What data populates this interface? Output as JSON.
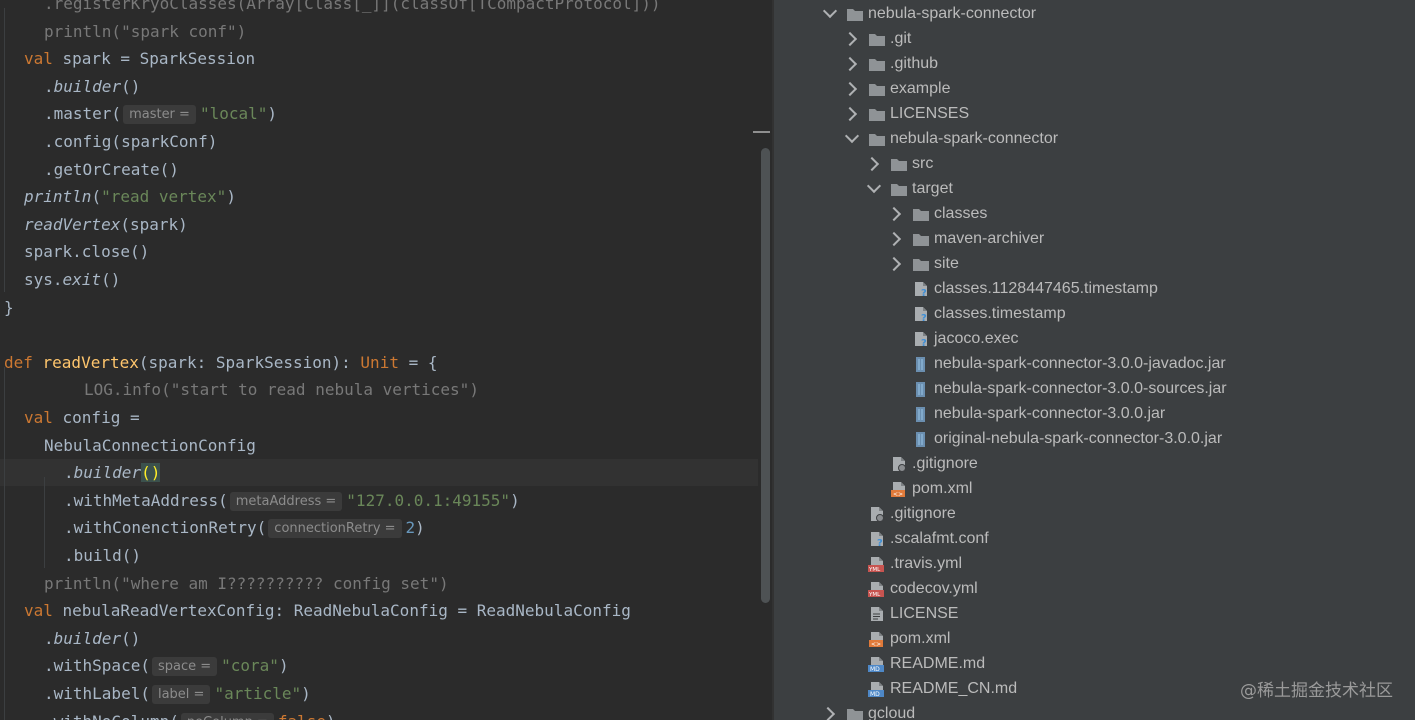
{
  "editor": {
    "lines": [
      {
        "indent": 1,
        "active": false,
        "tokens": [
          {
            "t": ".registerKryoClasses(Array[Class[_]](classOf[TCompactProtocol]))",
            "c": "tok-faded"
          }
        ]
      },
      {
        "indent": 1,
        "active": false,
        "tokens": [
          {
            "t": "println(\"spark conf\")",
            "c": "tok-faded"
          }
        ]
      },
      {
        "indent": 0,
        "active": false,
        "tokens": [
          {
            "t": "val ",
            "c": "tok-kw"
          },
          {
            "t": "spark = SparkSession"
          }
        ]
      },
      {
        "indent": 1,
        "active": false,
        "tokens": [
          {
            "t": "."
          },
          {
            "t": "builder",
            "c": "tok-it"
          },
          {
            "t": "()"
          }
        ]
      },
      {
        "indent": 1,
        "active": false,
        "tokens": [
          {
            "t": ".master("
          },
          {
            "hint": "master ="
          },
          {
            "t": "\"local\"",
            "c": "tok-str"
          },
          {
            "t": ")"
          }
        ]
      },
      {
        "indent": 1,
        "active": false,
        "tokens": [
          {
            "t": ".config(sparkConf)"
          }
        ]
      },
      {
        "indent": 1,
        "active": false,
        "tokens": [
          {
            "t": ".getOrCreate()"
          }
        ]
      },
      {
        "indent": 0,
        "active": false,
        "tokens": [
          {
            "t": "println",
            "c": "tok-it"
          },
          {
            "t": "("
          },
          {
            "t": "\"read vertex\"",
            "c": "tok-str"
          },
          {
            "t": ")"
          }
        ]
      },
      {
        "indent": 0,
        "active": false,
        "tokens": [
          {
            "t": "readVertex",
            "c": "tok-it"
          },
          {
            "t": "(spark)"
          }
        ]
      },
      {
        "indent": 0,
        "active": false,
        "tokens": [
          {
            "t": "spark.close()"
          }
        ]
      },
      {
        "indent": 0,
        "active": false,
        "tokens": [
          {
            "t": "sys."
          },
          {
            "t": "exit",
            "c": "tok-it"
          },
          {
            "t": "()"
          }
        ]
      },
      {
        "indent": -1,
        "active": false,
        "tokens": [
          {
            "t": "}"
          }
        ]
      },
      {
        "indent": -1,
        "active": false,
        "tokens": []
      },
      {
        "indent": -1,
        "active": false,
        "tokens": [
          {
            "t": "def ",
            "c": "tok-kw"
          },
          {
            "t": "readVertex",
            "c": "tok-fn"
          },
          {
            "t": "(spark: SparkSession): "
          },
          {
            "t": "Unit",
            "c": "tok-kw"
          },
          {
            "t": " = {"
          }
        ]
      },
      {
        "indent": 3,
        "active": false,
        "tokens": [
          {
            "t": "LOG.info(\"start to read nebula vertices\")",
            "c": "tok-faded"
          }
        ]
      },
      {
        "indent": 0,
        "active": false,
        "tokens": [
          {
            "t": "val ",
            "c": "tok-kw"
          },
          {
            "t": "config ="
          }
        ]
      },
      {
        "indent": 1,
        "active": false,
        "tokens": [
          {
            "t": "NebulaConnectionConfig"
          }
        ]
      },
      {
        "indent": 2,
        "active": true,
        "tokens": [
          {
            "t": "."
          },
          {
            "t": "builder",
            "c": "tok-it"
          },
          {
            "t": "()",
            "c": "tok-hl"
          }
        ]
      },
      {
        "indent": 2,
        "active": false,
        "tokens": [
          {
            "t": ".withMetaAddress("
          },
          {
            "hint": "metaAddress ="
          },
          {
            "t": "\"127.0.0.1:49155\"",
            "c": "tok-str"
          },
          {
            "t": ")"
          }
        ]
      },
      {
        "indent": 2,
        "active": false,
        "tokens": [
          {
            "t": ".withConenctionRetry("
          },
          {
            "hint": "connectionRetry ="
          },
          {
            "t": "2",
            "c": "tok-num"
          },
          {
            "t": ")"
          }
        ]
      },
      {
        "indent": 2,
        "active": false,
        "tokens": [
          {
            "t": ".build()"
          }
        ]
      },
      {
        "indent": 1,
        "active": false,
        "tokens": [
          {
            "t": "println(\"where am I?????????? config set\")",
            "c": "tok-faded"
          }
        ]
      },
      {
        "indent": 0,
        "active": false,
        "tokens": [
          {
            "t": "val ",
            "c": "tok-kw"
          },
          {
            "t": "nebulaReadVertexConfig: ReadNebulaConfig = ReadNebulaConfig"
          }
        ]
      },
      {
        "indent": 1,
        "active": false,
        "tokens": [
          {
            "t": "."
          },
          {
            "t": "builder",
            "c": "tok-it"
          },
          {
            "t": "()"
          }
        ]
      },
      {
        "indent": 1,
        "active": false,
        "tokens": [
          {
            "t": ".withSpace("
          },
          {
            "hint": "space ="
          },
          {
            "t": "\"cora\"",
            "c": "tok-str"
          },
          {
            "t": ")"
          }
        ]
      },
      {
        "indent": 1,
        "active": false,
        "tokens": [
          {
            "t": ".withLabel("
          },
          {
            "hint": "label ="
          },
          {
            "t": "\"article\"",
            "c": "tok-str"
          },
          {
            "t": ")"
          }
        ]
      },
      {
        "indent": 1,
        "active": false,
        "tokens": [
          {
            "t": ".withNoColumn("
          },
          {
            "hint": "noColumn ="
          },
          {
            "t": "false",
            "c": "tok-kw"
          },
          {
            "t": ")"
          }
        ]
      }
    ]
  },
  "tree": [
    {
      "depth": 0,
      "chevron": "open",
      "icon": "folder",
      "label": "nebula-spark-connector"
    },
    {
      "depth": 1,
      "chevron": "closed",
      "icon": "folder",
      "label": ".git"
    },
    {
      "depth": 1,
      "chevron": "closed",
      "icon": "folder",
      "label": ".github"
    },
    {
      "depth": 1,
      "chevron": "closed",
      "icon": "folder",
      "label": "example"
    },
    {
      "depth": 1,
      "chevron": "closed",
      "icon": "folder",
      "label": "LICENSES"
    },
    {
      "depth": 1,
      "chevron": "open",
      "icon": "folder",
      "label": "nebula-spark-connector"
    },
    {
      "depth": 2,
      "chevron": "closed",
      "icon": "folder",
      "label": "src"
    },
    {
      "depth": 2,
      "chevron": "open",
      "icon": "folder",
      "label": "target"
    },
    {
      "depth": 3,
      "chevron": "closed",
      "icon": "folder",
      "label": "classes"
    },
    {
      "depth": 3,
      "chevron": "closed",
      "icon": "folder",
      "label": "maven-archiver"
    },
    {
      "depth": 3,
      "chevron": "closed",
      "icon": "folder",
      "label": "site"
    },
    {
      "depth": 3,
      "chevron": "none",
      "icon": "unknown-file",
      "label": "classes.1128447465.timestamp"
    },
    {
      "depth": 3,
      "chevron": "none",
      "icon": "unknown-file",
      "label": "classes.timestamp"
    },
    {
      "depth": 3,
      "chevron": "none",
      "icon": "unknown-file",
      "label": "jacoco.exec"
    },
    {
      "depth": 3,
      "chevron": "none",
      "icon": "jar-file",
      "label": "nebula-spark-connector-3.0.0-javadoc.jar"
    },
    {
      "depth": 3,
      "chevron": "none",
      "icon": "jar-file",
      "label": "nebula-spark-connector-3.0.0-sources.jar"
    },
    {
      "depth": 3,
      "chevron": "none",
      "icon": "jar-file",
      "label": "nebula-spark-connector-3.0.0.jar"
    },
    {
      "depth": 3,
      "chevron": "none",
      "icon": "jar-file",
      "label": "original-nebula-spark-connector-3.0.0.jar"
    },
    {
      "depth": 2,
      "chevron": "none",
      "icon": "ignore-file",
      "label": ".gitignore"
    },
    {
      "depth": 2,
      "chevron": "none",
      "icon": "xml-file",
      "label": "pom.xml"
    },
    {
      "depth": 1,
      "chevron": "none",
      "icon": "ignore-file",
      "label": ".gitignore"
    },
    {
      "depth": 1,
      "chevron": "none",
      "icon": "unknown-file",
      "label": ".scalafmt.conf"
    },
    {
      "depth": 1,
      "chevron": "none",
      "icon": "yml-file",
      "label": ".travis.yml"
    },
    {
      "depth": 1,
      "chevron": "none",
      "icon": "yml-file",
      "label": "codecov.yml"
    },
    {
      "depth": 1,
      "chevron": "none",
      "icon": "text-file",
      "label": "LICENSE"
    },
    {
      "depth": 1,
      "chevron": "none",
      "icon": "xml-file",
      "label": "pom.xml"
    },
    {
      "depth": 1,
      "chevron": "none",
      "icon": "md-file",
      "label": "README.md"
    },
    {
      "depth": 1,
      "chevron": "none",
      "icon": "md-file",
      "label": "README_CN.md"
    },
    {
      "depth": 0,
      "chevron": "closed",
      "icon": "folder",
      "label": "gcloud"
    }
  ],
  "watermark": "@稀土掘金技术社区",
  "colors": {
    "folder": "#8f9396",
    "xml": "#e07a3a",
    "yml": "#c75450",
    "md": "#4e88c7",
    "jar": "#8ab4d4",
    "hint": "#3f8fd6"
  }
}
